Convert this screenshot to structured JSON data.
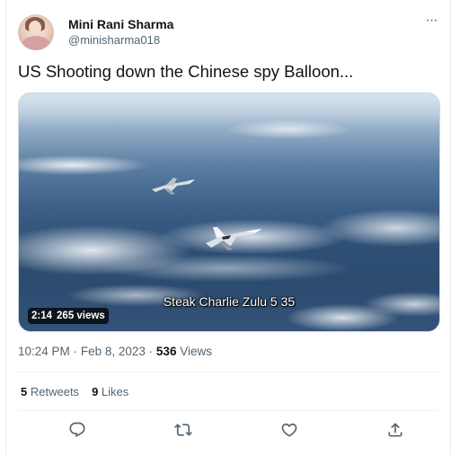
{
  "author": {
    "name": "Mini Rani Sharma",
    "handle": "@minisharma018"
  },
  "more_icon": "more-horizontal-icon",
  "tweet": {
    "text": "US Shooting down the Chinese spy Balloon..."
  },
  "media": {
    "subtitle": "Steak Charlie Zulu 5 35",
    "duration": "2:14",
    "views": "265 views"
  },
  "meta": {
    "time": "10:24 PM",
    "date": "Feb 8, 2023",
    "separator": "·",
    "view_count": "536",
    "views_label": "Views"
  },
  "stats": {
    "retweets_count": "5",
    "retweets_label": "Retweets",
    "likes_count": "9",
    "likes_label": "Likes"
  },
  "actions": {
    "reply_icon": "reply-icon",
    "retweet_icon": "retweet-icon",
    "like_icon": "heart-icon",
    "share_icon": "share-icon"
  }
}
